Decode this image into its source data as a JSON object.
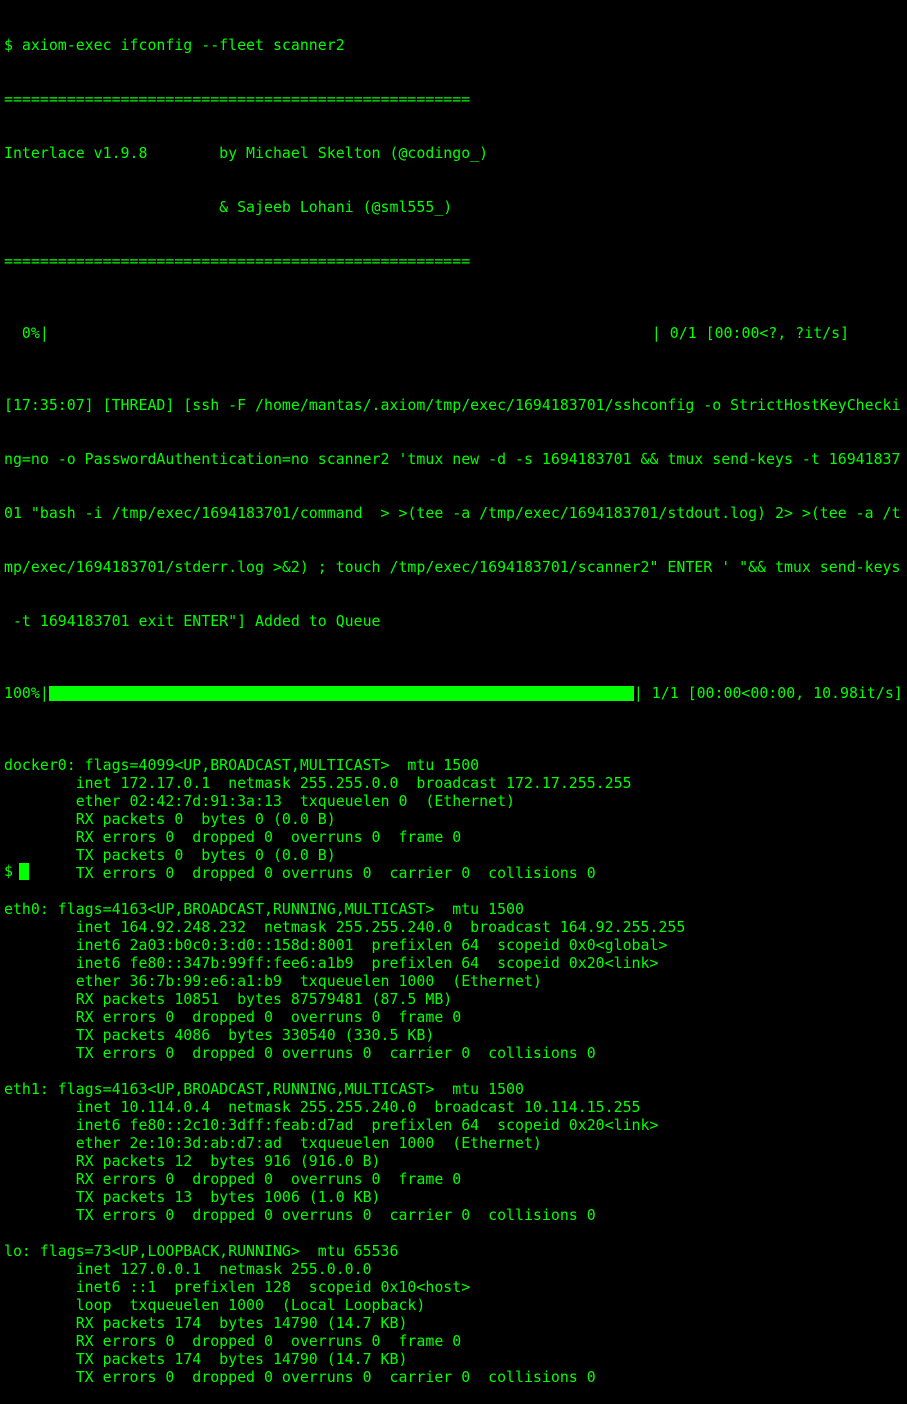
{
  "terminal": {
    "command_line": "$ axiom-exec ifconfig --fleet scanner2",
    "rule_top": "====================================================",
    "banner_1": "Interlace v1.9.8        by Michael Skelton (@codingo_)",
    "banner_2": "                        & Sajeeb Lohani (@sml555_)",
    "rule_bottom": "====================================================",
    "progress0_left": "  0%|",
    "progress0_right": "| 0/1 [00:00<?, ?it/s]",
    "thread_lines": [
      "[17:35:07] [THREAD] [ssh -F /home/mantas/.axiom/tmp/exec/1694183701/sshconfig -o StrictHostKeyChecki",
      "ng=no -o PasswordAuthentication=no scanner2 'tmux new -d -s 1694183701 && tmux send-keys -t 16941837",
      "01 \"bash -i /tmp/exec/1694183701/command  > >(tee -a /tmp/exec/1694183701/stdout.log) 2> >(tee -a /t",
      "mp/exec/1694183701/stderr.log >&2) ; touch /tmp/exec/1694183701/scanner2\" ENTER ' \"&& tmux send-keys",
      " -t 1694183701 exit ENTER\"] Added to Queue"
    ],
    "progress100_left": "100%|",
    "progress100_right": "| 1/1 [00:00<00:00, 10.98it/s]",
    "progress100_fraction": 1.0,
    "output_lines": [
      "docker0: flags=4099<UP,BROADCAST,MULTICAST>  mtu 1500",
      "        inet 172.17.0.1  netmask 255.255.0.0  broadcast 172.17.255.255",
      "        ether 02:42:7d:91:3a:13  txqueuelen 0  (Ethernet)",
      "        RX packets 0  bytes 0 (0.0 B)",
      "        RX errors 0  dropped 0  overruns 0  frame 0",
      "        TX packets 0  bytes 0 (0.0 B)",
      "        TX errors 0  dropped 0 overruns 0  carrier 0  collisions 0",
      "",
      "eth0: flags=4163<UP,BROADCAST,RUNNING,MULTICAST>  mtu 1500",
      "        inet 164.92.248.232  netmask 255.255.240.0  broadcast 164.92.255.255",
      "        inet6 2a03:b0c0:3:d0::158d:8001  prefixlen 64  scopeid 0x0<global>",
      "        inet6 fe80::347b:99ff:fee6:a1b9  prefixlen 64  scopeid 0x20<link>",
      "        ether 36:7b:99:e6:a1:b9  txqueuelen 1000  (Ethernet)",
      "        RX packets 10851  bytes 87579481 (87.5 MB)",
      "        RX errors 0  dropped 0  overruns 0  frame 0",
      "        TX packets 4086  bytes 330540 (330.5 KB)",
      "        TX errors 0  dropped 0 overruns 0  carrier 0  collisions 0",
      "",
      "eth1: flags=4163<UP,BROADCAST,RUNNING,MULTICAST>  mtu 1500",
      "        inet 10.114.0.4  netmask 255.255.240.0  broadcast 10.114.15.255",
      "        inet6 fe80::2c10:3dff:feab:d7ad  prefixlen 64  scopeid 0x20<link>",
      "        ether 2e:10:3d:ab:d7:ad  txqueuelen 1000  (Ethernet)",
      "        RX packets 12  bytes 916 (916.0 B)",
      "        RX errors 0  dropped 0  overruns 0  frame 0",
      "        TX packets 13  bytes 1006 (1.0 KB)",
      "        TX errors 0  dropped 0 overruns 0  carrier 0  collisions 0",
      "",
      "lo: flags=73<UP,LOOPBACK,RUNNING>  mtu 65536",
      "        inet 127.0.0.1  netmask 255.0.0.0",
      "        inet6 ::1  prefixlen 128  scopeid 0x10<host>",
      "        loop  txqueuelen 1000  (Local Loopback)",
      "        RX packets 174  bytes 14790 (14.7 KB)",
      "        RX errors 0  dropped 0  overruns 0  frame 0",
      "        TX packets 174  bytes 14790 (14.7 KB)",
      "        TX errors 0  dropped 0 overruns 0  carrier 0  collisions 0"
    ],
    "prompt": "$"
  },
  "colors": {
    "background": "#000000",
    "foreground": "#00ff00"
  }
}
